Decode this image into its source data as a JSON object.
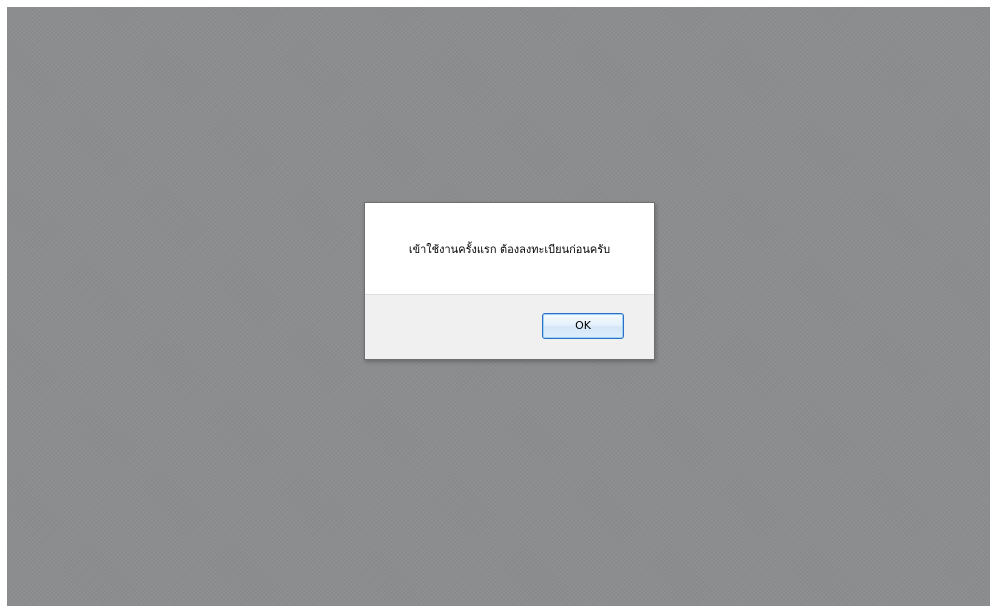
{
  "dialog": {
    "message": "เข้าใช้งานครั้งแรก ต้องลงทะเบียนก่อนครับ",
    "ok_label": "OK"
  },
  "colors": {
    "overlay": "#8c8d8f",
    "dialog_body": "#ffffff",
    "dialog_footer": "#f0f0f0",
    "button_border": "#2b6fc6"
  }
}
